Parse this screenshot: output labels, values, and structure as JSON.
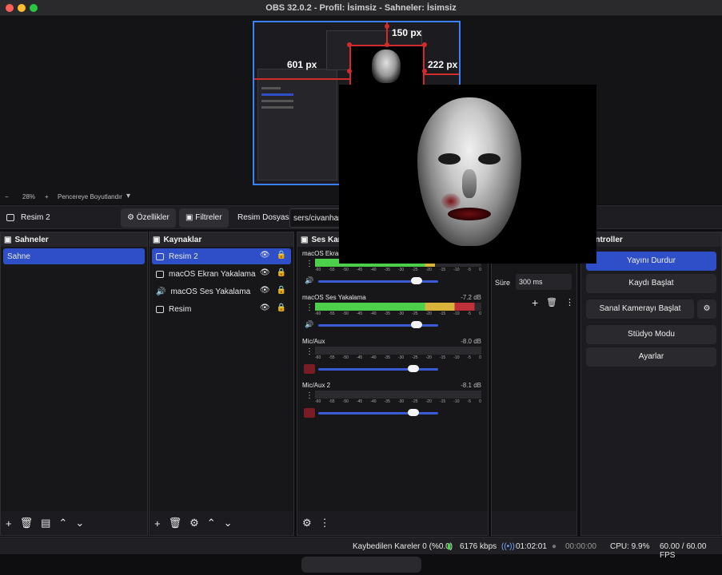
{
  "window": {
    "title": "OBS 32.0.2 - Profil: İsimsiz - Sahneler: İsimsiz"
  },
  "preview": {
    "measure_top": "150 px",
    "measure_left": "601 px",
    "measure_right": "222 px"
  },
  "zoom": {
    "minus": "−",
    "value": "28%",
    "plus": "+",
    "fit_label": "Pencereye Boyutlandır",
    "caret": "▾"
  },
  "context": {
    "source_name": "Resim 2",
    "properties": "Özellikler",
    "filters": "Filtreler",
    "file_label": "Resim Dosyası",
    "file_path": "sers/civanhan/"
  },
  "scenes": {
    "title": "Sahneler",
    "items": [
      "Sahne"
    ]
  },
  "sources": {
    "title": "Kaynaklar",
    "items": [
      "Resim 2",
      "macOS Ekran Yakalama",
      "macOS Ses Yakalama",
      "Resim"
    ]
  },
  "mixer": {
    "title": "Ses Karış",
    "tracks": [
      {
        "name": "macOS Ekran Y",
        "db": "",
        "level": 0.72,
        "volume": 0.82
      },
      {
        "name": "macOS Ses Yakalama",
        "db": "-7.2 dB",
        "level": 0.96,
        "volume": 0.82
      },
      {
        "name": "Mic/Aux",
        "db": "-8.0 dB",
        "level": 0.0,
        "volume": 0.79
      },
      {
        "name": "Mic/Aux 2",
        "db": "-8.1 dB",
        "level": 0.0,
        "volume": 0.79
      }
    ],
    "scale": [
      "-60",
      "-55",
      "-50",
      "-45",
      "-40",
      "-35",
      "-30",
      "-25",
      "-20",
      "-15",
      "-10",
      "-5",
      "0"
    ]
  },
  "transitions": {
    "duration_label": "Süre",
    "duration_value": "300 ms"
  },
  "controls": {
    "title": "Controller",
    "stop_stream": "Yayını Durdur",
    "start_record": "Kaydı Başlat",
    "virtual_cam": "Sanal Kamerayı Başlat",
    "studio_mode": "Stüdyo Modu",
    "settings": "Ayarlar"
  },
  "status": {
    "dropped": "Kaybedilen Kareler 0 (%0.0)",
    "bitrate": "6176 kbps",
    "stream_time": "01:02:01",
    "record_time": "00:00:00",
    "cpu": "CPU: 9.9%",
    "fps": "60.00 / 60.00 FPS"
  },
  "colors": {
    "accent": "#2e4fc7",
    "meter_green": "#4cd04c",
    "meter_yellow": "#d8b43a",
    "meter_red": "#c0303a",
    "guide_red": "#d32a2a"
  }
}
